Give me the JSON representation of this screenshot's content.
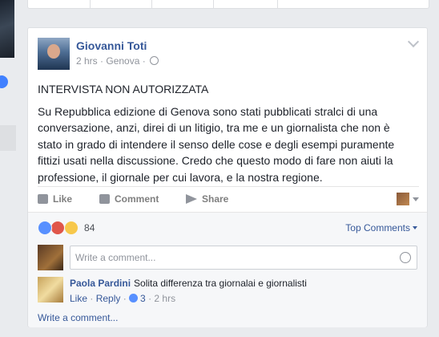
{
  "post": {
    "author": "Giovanni Toti",
    "time": "2 hrs",
    "location": "Genova",
    "heading": "INTERVISTA NON AUTORIZZATA",
    "body": "Su Repubblica edizione di Genova sono stati pubblicati stralci di una conversazione, anzi, direi di un litigio, tra me e un giornalista che non è stato in grado di intendere il senso delle cose e degli esempi puramente fittizi usati nella discussione. Credo che questo modo di fare non aiuti la professione, il giornale per cui lavora, e la nostra regione."
  },
  "actions": {
    "like": "Like",
    "comment": "Comment",
    "share": "Share"
  },
  "reactions": {
    "count": "84",
    "sort_label": "Top Comments"
  },
  "comment_box": {
    "placeholder": "Write a comment..."
  },
  "comments": [
    {
      "name": "Paola Pardini",
      "text": "Solita differenza tra giornalai e giornalisti",
      "like_label": "Like",
      "reply_label": "Reply",
      "likes": "3",
      "time": "2 hrs"
    }
  ],
  "footer": {
    "write_comment": "Write a comment..."
  }
}
